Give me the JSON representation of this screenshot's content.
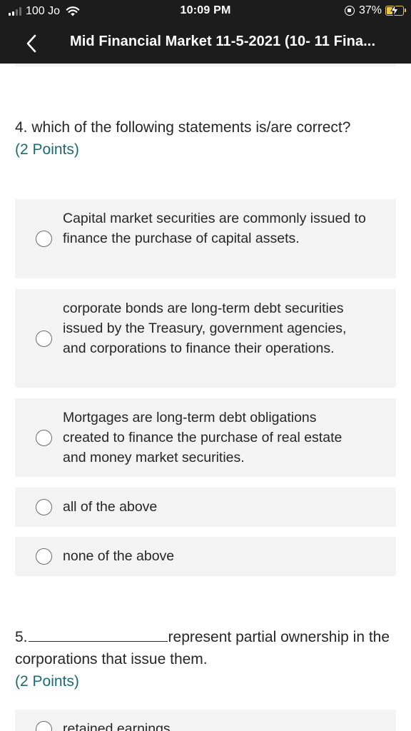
{
  "status_bar": {
    "carrier": "100 Jo",
    "time": "10:09 PM",
    "battery_percent": "37%",
    "battery_level": 0.37,
    "icons": [
      "signal-icon",
      "wifi-icon",
      "rotation-lock-icon",
      "battery-charging-icon"
    ],
    "battery_color": "#e8c84a"
  },
  "nav": {
    "back_icon": "chevron-left-icon",
    "title": "Mid Financial Market 11-5-2021 (10- 11 Fina..."
  },
  "questions": [
    {
      "number": "4.",
      "text": "which of the following statements is/are correct?",
      "points": "(2 Points)",
      "options": [
        "Capital market securities are commonly issued to finance the purchase of capital assets.",
        "corporate bonds are long-term debt securities issued by the Treasury, government agencies, and corporations to finance their operations.",
        "Mortgages are long-term debt obligations created to finance the purchase of real estate and money market securities.",
        "all of the above",
        "none of the above"
      ]
    },
    {
      "number": "5.",
      "text": "represent partial ownership in the corporations that issue them.",
      "points": "(2 Points)",
      "options": [
        "retained earnings"
      ]
    }
  ],
  "colors": {
    "header_bg": "#1c1c1c",
    "option_bg": "#f3f3f3",
    "points_text": "#1a6b75"
  }
}
